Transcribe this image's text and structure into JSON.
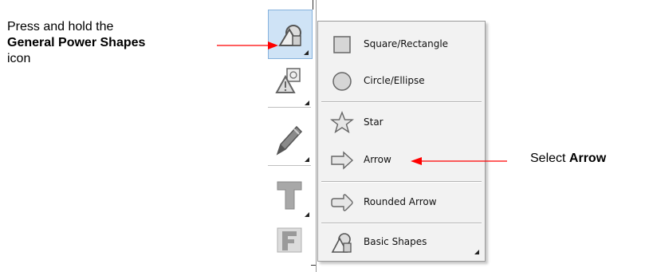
{
  "annotations": {
    "left_line1": "Press and hold the",
    "left_bold": "General Power Shapes",
    "left_line3": "icon",
    "right_prefix": "Select ",
    "right_bold": "Arrow"
  },
  "toolbar": {
    "tools": [
      {
        "name": "general-power-shapes",
        "icon": "shapes-icon",
        "active": true
      },
      {
        "name": "warning-shapes",
        "icon": "warning-shapes-icon",
        "active": false
      },
      {
        "name": "pencil",
        "icon": "pencil-icon",
        "active": false
      },
      {
        "name": "text",
        "icon": "text-icon",
        "active": false
      },
      {
        "name": "fill-text",
        "icon": "fill-text-icon",
        "active": false
      }
    ]
  },
  "menu": {
    "items": [
      {
        "label": "Square/Rectangle",
        "icon": "square-icon"
      },
      {
        "label": "Circle/Ellipse",
        "icon": "circle-icon"
      },
      {
        "label": "Star",
        "icon": "star-icon"
      },
      {
        "label": "Arrow",
        "icon": "arrow-icon"
      },
      {
        "label": "Rounded Arrow",
        "icon": "rounded-arrow-icon"
      },
      {
        "label": "Basic Shapes",
        "icon": "basic-shapes-icon"
      }
    ]
  },
  "colors": {
    "callout_arrow": "#ff0000",
    "active_tool_bg": "#cfe3f6",
    "menu_bg": "#f2f2f2"
  }
}
